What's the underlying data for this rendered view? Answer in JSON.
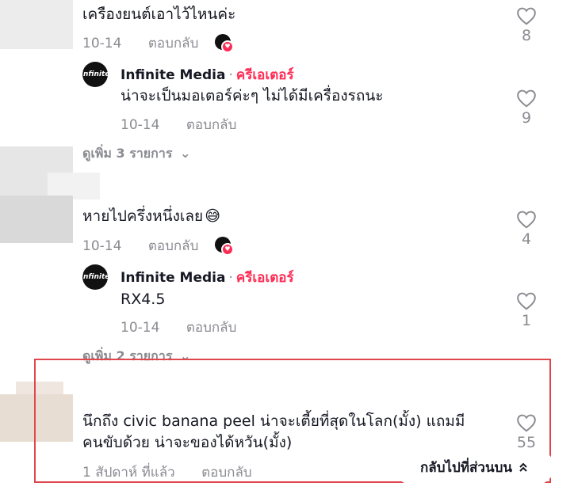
{
  "comments": [
    {
      "text": "เครืองยนต์เอาไว้ไหนค่ะ",
      "date": "10-14",
      "reply_label": "ตอบกลับ",
      "likes": "8",
      "replies": [
        {
          "author": "Infinite Media",
          "separator": "·",
          "badge": "ครีเอเตอร์",
          "text": "น่าจะเป็นมอเตอร์ค่ะๆ ไม่ได้มีเครื่องรถนะ",
          "date": "10-14",
          "reply_label": "ตอบกลับ",
          "likes": "9"
        }
      ],
      "more_label": "ดูเพิ่ม 3 รายการ"
    },
    {
      "text": "หายไปครึ่งหนึ่งเลย",
      "emoji": "😅",
      "date": "10-14",
      "reply_label": "ตอบกลับ",
      "likes": "4",
      "replies": [
        {
          "author": "Infinite Media",
          "separator": "·",
          "badge": "ครีเอเตอร์",
          "text": "RX4.5",
          "date": "10-14",
          "reply_label": "ตอบกลับ",
          "likes": "1"
        }
      ],
      "more_label": "ดูเพิ่ม 2 รายการ"
    },
    {
      "text_line1": "นึกถึง civic banana peel น่าจะเตี้ยที่สุดในโลก(มั้ง) แถมมี",
      "text_line2": "คนขับด้วย น่าจะของได้หวัน(มั้ง)",
      "date": "1 สัปดาห์ ที่แล้ว",
      "reply_label": "ตอบกลับ",
      "likes": "55"
    }
  ],
  "avatar_text": "Infinite",
  "back_to_top": {
    "label": "กลับไปที่ส่วนบน",
    "icon": "double-chevron-up-icon"
  },
  "colors": {
    "creator_badge": "#fe2c55",
    "highlight_border": "#e0474c",
    "meta": "#8a8b91"
  }
}
